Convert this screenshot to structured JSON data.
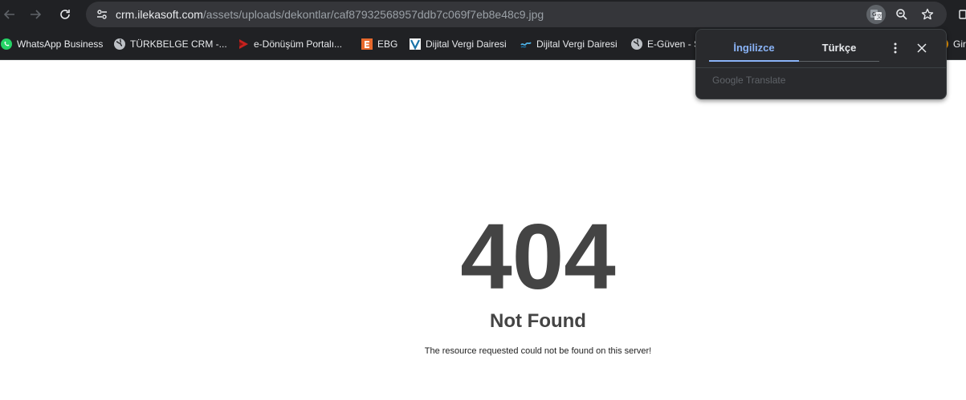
{
  "address_bar": {
    "host": "crm.ilekasoft.com",
    "path": "/assets/uploads/dekontlar/caf87932568957ddb7c069f7eb8e48c9.jpg"
  },
  "bookmarks": [
    {
      "label": "WhatsApp Business",
      "icon": "whatsapp-icon"
    },
    {
      "label": "TÜRKBELGE CRM -...",
      "icon": "globe-icon"
    },
    {
      "label": "e-Dönüşüm Portalı...",
      "icon": "play-icon"
    },
    {
      "label": "EBG",
      "icon": "ebg-logo-icon"
    },
    {
      "label": "Dijital Vergi Dairesi",
      "icon": "gib-logo-icon"
    },
    {
      "label": "Dijital Vergi Dairesi",
      "icon": "gib-logo-icon"
    },
    {
      "label": "E-Güven - S",
      "icon": "globe-icon"
    },
    {
      "label": "Gir",
      "icon": "orange-icon"
    }
  ],
  "translate_popup": {
    "source_language": "İngilizce",
    "target_language": "Türkçe",
    "brand": "Google Translate"
  },
  "page": {
    "code": "404",
    "title": "Not Found",
    "message": "The resource requested could not be found on this server!"
  },
  "colors": {
    "chrome_dark": "#202124",
    "omnibox": "#35363a",
    "accent_blue": "#8ab4f8",
    "error_text": "#444444"
  }
}
